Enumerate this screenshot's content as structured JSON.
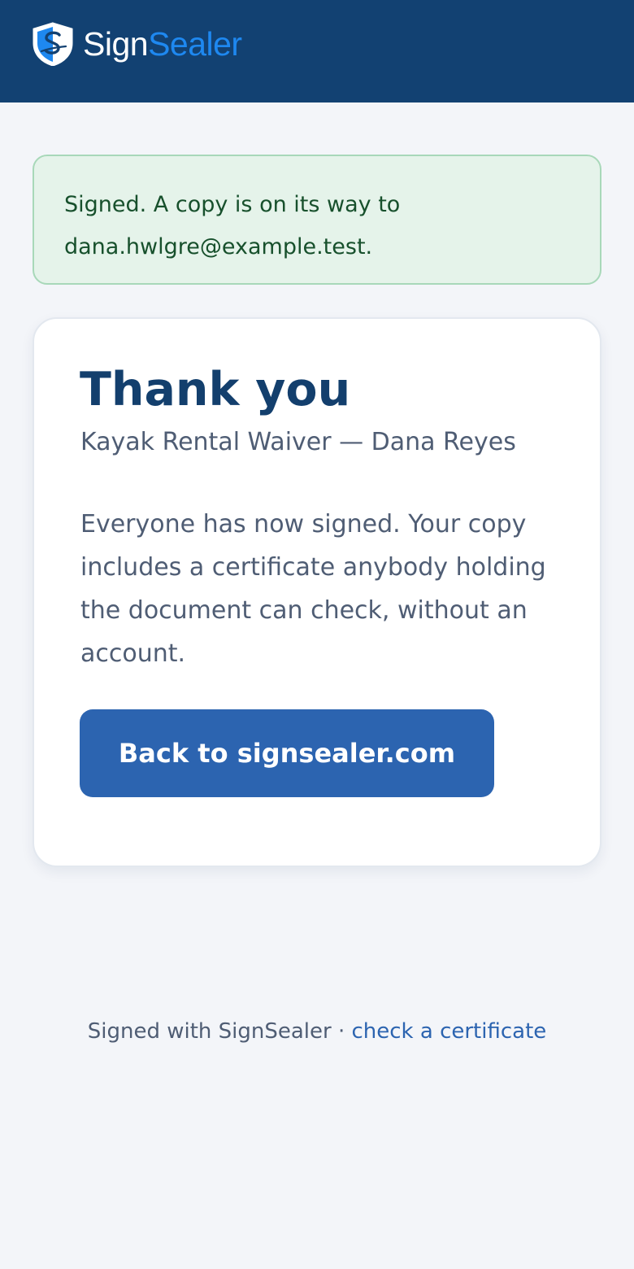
{
  "header": {
    "logo_icon": "shield-s-icon",
    "brand_part_1": "Sign",
    "brand_part_2": "Sealer",
    "brand_color": "#1e88f0",
    "background_color": "#124172"
  },
  "notice": {
    "text": "Signed. A copy is on its way to dana.hwlgre@example.test.",
    "status_color": "#17502c"
  },
  "card": {
    "title": "Thank you",
    "subtitle": "Kayak Rental Waiver — Dana Reyes",
    "body": "Everyone has now signed. Your copy includes a certificate anybody holding the document can check, without an account.",
    "button_label": "Back to signsealer.com",
    "button_color": "#2c64b0"
  },
  "footer": {
    "prefix": "Signed with SignSealer · ",
    "link_label": "check a certificate"
  }
}
